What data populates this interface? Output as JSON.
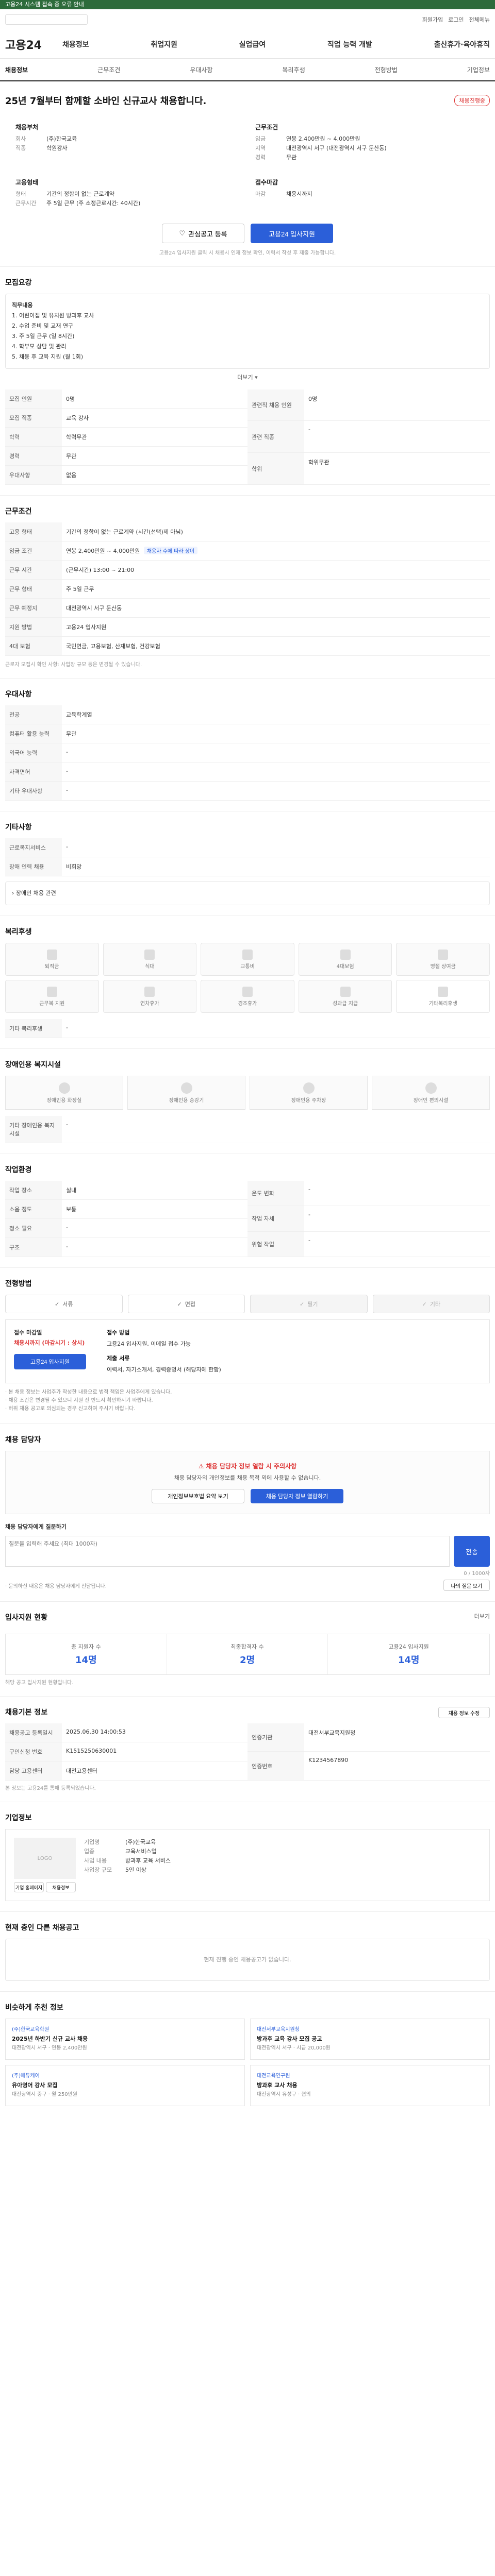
{
  "notice": "고용24 시스템 접속 중 오류 안내",
  "utility": {
    "signup": "회원가입",
    "login": "로그인",
    "menu": "전체메뉴"
  },
  "logo": "고용24",
  "gnb": [
    "채용정보",
    "취업지원",
    "실업급여",
    "직업 능력 개발",
    "출산휴가·육아휴직"
  ],
  "tabs": [
    "채용정보",
    "근무조건",
    "우대사항",
    "복리후생",
    "전형방법",
    "기업정보"
  ],
  "job": {
    "title": "25년 7월부터 함께할 소바인 신규교사 채용합니다.",
    "badge": "채용진행중",
    "company_h": "채용부처",
    "company_rows": [
      {
        "k": "회사",
        "v": "(주)한국교육"
      },
      {
        "k": "직종",
        "v": "학원강사"
      }
    ],
    "cond_h": "근무조건",
    "cond_rows": [
      {
        "k": "임금",
        "v": "연봉 2,400만원 ~ 4,000만원"
      },
      {
        "k": "지역",
        "v": "대전광역시 서구 (대전광역시 서구 둔산동)"
      },
      {
        "k": "경력",
        "v": "무관"
      }
    ],
    "emp_h": "고용형태",
    "emp_rows": [
      {
        "k": "형태",
        "v": "기간의 정함이 없는 근로계약"
      },
      {
        "k": "근무시간",
        "v": "주 5일 근무 (주 소정근로시간: 40시간)"
      }
    ],
    "apply_h": "접수마감",
    "apply_rows": [
      {
        "k": "마감",
        "v": "채용시까지"
      }
    ],
    "btn_scrap": "관심공고 등록",
    "btn_apply": "고용24 입사지원",
    "note": "고용24 입사지원 클릭 시 채용시 인재 정보 확인, 이력서 작성 후 제출 가능합니다."
  },
  "duty": {
    "title": "모집요강",
    "box_title": "직무내용",
    "lines": [
      "1. 어린이집 및 유치원 방과후 교사",
      "2. 수업 준비 및 교재 연구",
      "3. 주 5일 근무 (일 8시간)",
      "4. 학부모 상담 및 관리",
      "5. 채용 후 교육 지원 (월 1회)"
    ],
    "more": "더보기"
  },
  "recruit": {
    "rows": [
      {
        "k": "모집 인원",
        "v": "0명"
      },
      {
        "k": "모집 직종",
        "v": "교육 강사"
      },
      {
        "k": "학력",
        "v": "학력무관"
      },
      {
        "k": "경력",
        "v": "무관"
      },
      {
        "k": "우대사항",
        "v": "없음"
      }
    ],
    "right_rows": [
      {
        "k": "관련직 채용 인원",
        "v": "0명"
      },
      {
        "k": "관련 직종",
        "v": "-"
      },
      {
        "k": "학위",
        "v": "학위무관"
      }
    ]
  },
  "work": {
    "title": "근무조건",
    "rows": [
      {
        "k": "고용 형태",
        "v": "기간의 정함이 없는 근로계약 (시간(선택)제 아님)"
      },
      {
        "k": "임금 조건",
        "v": "연봉 2,400만원 ~ 4,000만원"
      },
      {
        "k": "근무 시간",
        "v": "(근무시간) 13:00 ~ 21:00"
      },
      {
        "k": "근무 형태",
        "v": "주 5일 근무"
      },
      {
        "k": "근무 예정지",
        "v": "대전광역시 서구 둔산동"
      },
      {
        "k": "지원 방법",
        "v": "고용24 입사지원"
      },
      {
        "k": "4대 보험",
        "v": "국민연금, 고용보험, 산재보험, 건강보험"
      }
    ],
    "tag": "채용자 수에 따라 상이",
    "note": "근로자 모집시 확인 사항: 사업장 규모 등은 변경될 수 있습니다."
  },
  "pref": {
    "title": "우대사항",
    "rows": [
      {
        "k": "전공",
        "v": "교육학계열"
      },
      {
        "k": "컴퓨터 활용 능력",
        "v": "무관"
      },
      {
        "k": "외국어 능력",
        "v": "-"
      },
      {
        "k": "자격면허",
        "v": "-"
      },
      {
        "k": "기타 우대사항",
        "v": "-"
      }
    ]
  },
  "etc": {
    "title": "기타사항",
    "rows": [
      {
        "k": "근로복지서비스",
        "v": "-"
      },
      {
        "k": "장애 인력 채용",
        "v": "비희망"
      }
    ],
    "extra": "장애인 채용 관련"
  },
  "welfare": {
    "title": "복리후생",
    "items": [
      "퇴직금",
      "식대",
      "교통비",
      "4대보험",
      "명절 상여금",
      "근무복 지원",
      "연차휴가",
      "경조휴가",
      "성과급 지급",
      "기타복리후생"
    ],
    "extra_k": "기타 복리후생",
    "extra_v": "-"
  },
  "facility": {
    "title": "장애인용 복지시설",
    "items": [
      "장애인용 화장실",
      "장애인용 승강기",
      "장애인용 주차장",
      "장애인 편의시설"
    ],
    "extra_k": "기타 장애인용 복지시설",
    "extra_v": "-"
  },
  "env": {
    "title": "작업환경",
    "rows": [
      {
        "k": "작업 장소",
        "v": "실내"
      },
      {
        "k": "소음 정도",
        "v": "보통"
      },
      {
        "k": "청소 필요",
        "v": "-"
      },
      {
        "k": "구조",
        "v": "-"
      }
    ],
    "right_rows": [
      {
        "k": "온도 변화",
        "v": "-"
      },
      {
        "k": "작업 자세",
        "v": "-"
      },
      {
        "k": "위험 작업",
        "v": "-"
      }
    ]
  },
  "process": {
    "title": "전형방법",
    "steps": [
      "서류",
      "면접",
      "필기",
      "기타"
    ],
    "apply_h": "접수 마감일",
    "apply_red": "채용시까지 (마감시기 : 상시)",
    "apply_btn": "고용24 입사지원",
    "r1_h": "접수 방법",
    "r1": "고용24 입사지원, 이메일 접수 가능",
    "r2_h": "제출 서류",
    "r2": "이력서, 자기소개서, 경력증명서 (해당자에 한함)",
    "bullets": [
      "· 본 채용 정보는 사업주가 작성한 내용으로 법적 책임은 사업주에게 있습니다.",
      "· 채용 조건은 변경될 수 있으니 지원 전 반드시 확인하시기 바랍니다.",
      "· 허위 채용 공고로 의심되는 경우 신고하여 주시기 바랍니다."
    ]
  },
  "contact": {
    "title": "채용 담당자",
    "alert_title": "채용 담당자 정보 열람 시 주의사항",
    "alert_body": "채용 담당자의 개인정보를 채용 목적 외에 사용할 수 없습니다.",
    "btn1": "개인정보보호법 요약 보기",
    "btn2": "채용 담당자 정보 열람하기",
    "inq_h": "채용 담당자에게 질문하기",
    "inq_placeholder": "질문을 입력해 주세요 (최대 1000자)",
    "inq_btn": "전송",
    "inq_count": "0 / 1000자",
    "inq_note": "· 문의하신 내용은 채용 담당자에게 전달됩니다.",
    "inq_btn2": "나의 질문 보기"
  },
  "stats": {
    "title": "입사지원 현황",
    "more": "더보기",
    "items": [
      {
        "k": "총 지원자 수",
        "v": "14명"
      },
      {
        "k": "최종합격자 수",
        "v": "2명"
      },
      {
        "k": "고용24 입사지원",
        "v": "14명"
      }
    ],
    "note": "해당 공고 입사지원 현황입니다."
  },
  "info": {
    "title": "채용기본 정보",
    "btn": "채용 정보 수정",
    "rows": [
      {
        "k": "채용공고 등록일시",
        "v": "2025.06.30 14:00:53"
      },
      {
        "k": "구인신청 번호",
        "v": "K1515250630001"
      },
      {
        "k": "담당 고용센터",
        "v": "대전고용센터"
      }
    ],
    "right_rows": [
      {
        "k": "인증기관",
        "v": "대전서부교육지원청"
      },
      {
        "k": "인증번호",
        "v": "K1234567890"
      }
    ],
    "note": "본 정보는 고용24를 통해 등록되었습니다."
  },
  "company": {
    "title": "기업정보",
    "logo_text": "LOGO",
    "rows": [
      {
        "k": "기업명",
        "v": "(주)한국교육"
      },
      {
        "k": "업종",
        "v": "교육서비스업"
      },
      {
        "k": "사업 내용",
        "v": "방과후 교육 서비스"
      },
      {
        "k": "사업장 규모",
        "v": "5인 이상"
      }
    ],
    "btn1": "기업 홈페이지",
    "btn2": "채용정보"
  },
  "others": {
    "title": "현재 충인 다른 채용공고",
    "empty": "현재 진행 중인 채용공고가 없습니다."
  },
  "rec": {
    "title": "비슷하게 추천 정보",
    "items": [
      {
        "co": "(주)한국교육학원",
        "tt": "2025년 하반기 신규 교사 채용",
        "meta": "대전광역시 서구 · 연봉 2,400만원"
      },
      {
        "co": "대전서부교육지원청",
        "tt": "방과후 교육 강사 모집 공고",
        "meta": "대전광역시 서구 · 시급 20,000원"
      },
      {
        "co": "(주)에듀케어",
        "tt": "유아영어 강사 모집",
        "meta": "대전광역시 중구 · 월 250만원"
      },
      {
        "co": "대전교육연구원",
        "tt": "방과후 교사 채용",
        "meta": "대전광역시 유성구 · 협의"
      }
    ]
  }
}
